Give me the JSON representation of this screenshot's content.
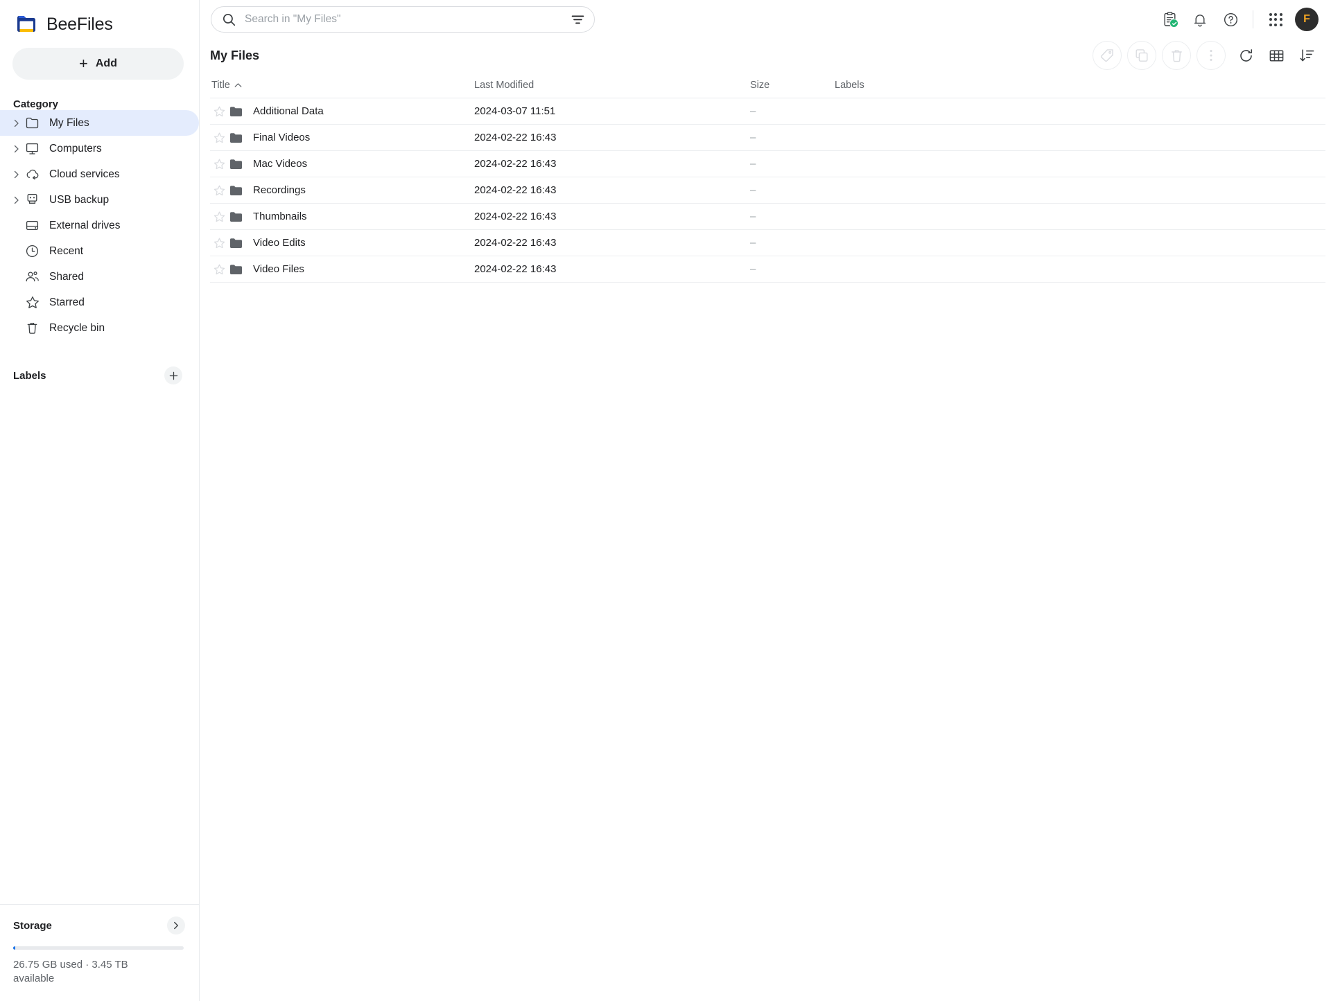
{
  "app": {
    "name": "BeeFiles",
    "logo_icon": "folder-logo-icon"
  },
  "sidebar": {
    "add_button": {
      "label": "Add",
      "icon": "plus-icon"
    },
    "category_heading": "Category",
    "items": [
      {
        "label": "My Files",
        "icon": "folder-icon",
        "expandable": true,
        "active": true
      },
      {
        "label": "Computers",
        "icon": "computer-icon",
        "expandable": true,
        "active": false
      },
      {
        "label": "Cloud services",
        "icon": "cloud-sync-icon",
        "expandable": true,
        "active": false
      },
      {
        "label": "USB backup",
        "icon": "usb-drive-icon",
        "expandable": true,
        "active": false
      },
      {
        "label": "External drives",
        "icon": "hard-drive-icon",
        "expandable": false,
        "active": false
      },
      {
        "label": "Recent",
        "icon": "clock-icon",
        "expandable": false,
        "active": false
      },
      {
        "label": "Shared",
        "icon": "people-icon",
        "expandable": false,
        "active": false
      },
      {
        "label": "Starred",
        "icon": "star-icon",
        "expandable": false,
        "active": false
      },
      {
        "label": "Recycle bin",
        "icon": "trash-icon",
        "expandable": false,
        "active": false
      }
    ],
    "labels_heading": "Labels",
    "labels_add_icon": "plus-icon",
    "storage": {
      "heading": "Storage",
      "chevron_icon": "chevron-right-icon",
      "used_percent": 1.1,
      "summary": "26.75 GB used  ·  3.45 TB available",
      "bar_color": "#1a73e8"
    }
  },
  "topbar": {
    "search": {
      "placeholder": "Search in \"My Files\"",
      "value": "",
      "icon": "search-icon",
      "filter_icon": "filter-icon"
    },
    "actions": [
      {
        "name": "activity-icon",
        "badge": true
      },
      {
        "name": "notifications-icon",
        "badge": false
      },
      {
        "name": "help-icon",
        "badge": false
      }
    ],
    "apps_icon": "apps-grid-icon",
    "avatar": {
      "initial": "F",
      "bg": "#2d2d2d",
      "fg": "#f5a623"
    }
  },
  "page": {
    "title": "My Files",
    "toolbar_disabled": [
      {
        "name": "tag-icon"
      },
      {
        "name": "copy-icon"
      },
      {
        "name": "delete-icon"
      },
      {
        "name": "more-vertical-icon"
      }
    ],
    "toolbar_active": [
      {
        "name": "refresh-icon"
      },
      {
        "name": "grid-view-icon"
      },
      {
        "name": "sort-icon"
      }
    ]
  },
  "table": {
    "columns": [
      {
        "label": "Title",
        "sort_icon": "chevron-up-icon"
      },
      {
        "label": "Last Modified",
        "sort_icon": ""
      },
      {
        "label": "Size",
        "sort_icon": ""
      },
      {
        "label": "Labels",
        "sort_icon": ""
      }
    ],
    "rows": [
      {
        "star": "star-outline-icon",
        "icon": "folder-filled-icon",
        "title": "Additional Data",
        "modified": "2024-03-07 11:51",
        "size": "–",
        "labels": ""
      },
      {
        "star": "star-outline-icon",
        "icon": "folder-filled-icon",
        "title": "Final Videos",
        "modified": "2024-02-22 16:43",
        "size": "–",
        "labels": ""
      },
      {
        "star": "star-outline-icon",
        "icon": "folder-filled-icon",
        "title": "Mac Videos",
        "modified": "2024-02-22 16:43",
        "size": "–",
        "labels": ""
      },
      {
        "star": "star-outline-icon",
        "icon": "folder-filled-icon",
        "title": "Recordings",
        "modified": "2024-02-22 16:43",
        "size": "–",
        "labels": ""
      },
      {
        "star": "star-outline-icon",
        "icon": "folder-filled-icon",
        "title": "Thumbnails",
        "modified": "2024-02-22 16:43",
        "size": "–",
        "labels": ""
      },
      {
        "star": "star-outline-icon",
        "icon": "folder-filled-icon",
        "title": "Video Edits",
        "modified": "2024-02-22 16:43",
        "size": "–",
        "labels": ""
      },
      {
        "star": "star-outline-icon",
        "icon": "folder-filled-icon",
        "title": "Video Files",
        "modified": "2024-02-22 16:43",
        "size": "–",
        "labels": ""
      }
    ]
  }
}
